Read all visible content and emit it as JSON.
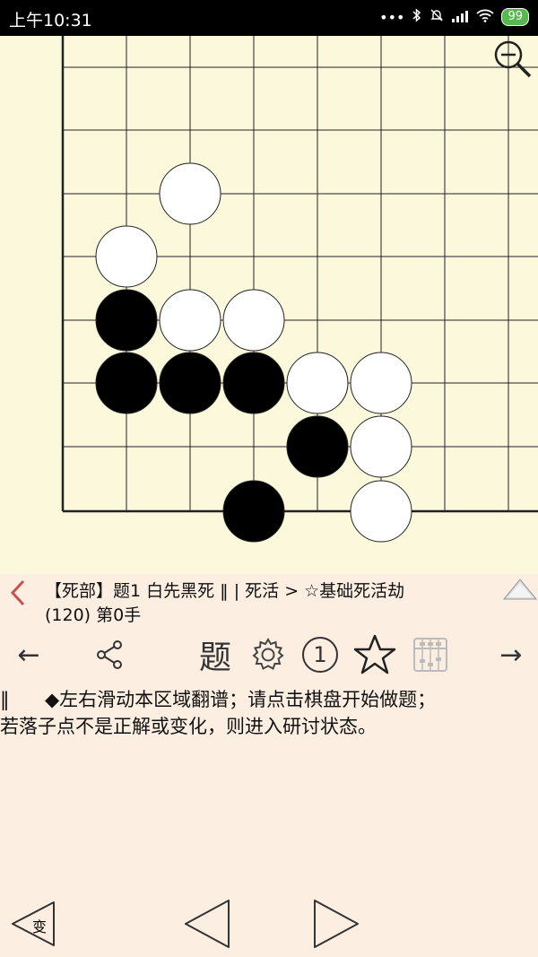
{
  "status": {
    "time": "上午10:31",
    "battery": "99"
  },
  "problem": {
    "title": "【死部】题1 白先黑死 ‖ | 死活 > ☆基础死活劫",
    "subtitle": "(120) 第0手"
  },
  "toolbar": {
    "prev_label": "←",
    "next_label": "→",
    "problem_label": "题",
    "number_badge": "1"
  },
  "description": {
    "marker": "‖",
    "line1": "◆左右滑动本区域翻谱；请点击棋盘开始做题；",
    "line2": "若落子点不是正解或变化，则进入研讨状态。"
  },
  "bottom_nav": {
    "variation_label": "变"
  },
  "board": {
    "white_stones": [
      [
        2,
        2
      ],
      [
        1,
        3
      ],
      [
        2,
        4
      ],
      [
        3,
        4
      ],
      [
        4,
        5
      ],
      [
        5,
        5
      ],
      [
        5,
        6
      ],
      [
        5,
        7
      ]
    ],
    "black_stones": [
      [
        1,
        4
      ],
      [
        1,
        5
      ],
      [
        2,
        5
      ],
      [
        3,
        5
      ],
      [
        4,
        6
      ],
      [
        3,
        7
      ]
    ]
  }
}
